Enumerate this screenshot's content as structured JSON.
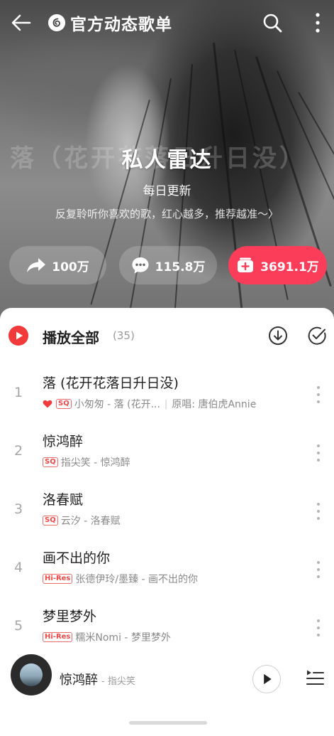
{
  "topbar": {
    "title": "官方动态歌单",
    "back_icon": "back-arrow-icon",
    "search_icon": "search-icon",
    "more_icon": "more-vertical-icon"
  },
  "hero": {
    "background_text": "落（花开花落日升日没）",
    "title": "私人雷达",
    "update_label": "每日更新",
    "description": "反复聆听你喜欢的歌，红心越多，推荐越准～",
    "description_arrow": "〉"
  },
  "stats": {
    "share": "100万",
    "comment": "115.8万",
    "collect": "3691.1万"
  },
  "list_header": {
    "play_all": "播放全部",
    "count": "(35)"
  },
  "songs": [
    {
      "index": "1",
      "title": "落 (花开花落日升日没)",
      "liked": true,
      "quality": "SQ",
      "artist": "小匆匆 - 落 (花开...",
      "extra": "原唱: 唐伯虎Annie"
    },
    {
      "index": "2",
      "title": "惊鸿醉",
      "liked": false,
      "quality": "SQ",
      "artist": "指尖笑 - 惊鸿醉",
      "extra": ""
    },
    {
      "index": "3",
      "title": "洛春赋",
      "liked": false,
      "quality": "SQ",
      "artist": "云汐 - 洛春赋",
      "extra": ""
    },
    {
      "index": "4",
      "title": "画不出的你",
      "liked": false,
      "quality": "Hi-Res",
      "artist": "张德伊玲/墨臻 - 画不出的你",
      "extra": ""
    },
    {
      "index": "5",
      "title": "梦里梦外",
      "liked": false,
      "quality": "Hi-Res",
      "artist": "糯米Nomi - 梦里梦外",
      "extra": ""
    }
  ],
  "player": {
    "title": "惊鸿醉",
    "artist": "- 指尖笑"
  },
  "colors": {
    "accent": "#fc3d5a",
    "play_red": "#f23a3a",
    "quality_red": "#f04848"
  }
}
